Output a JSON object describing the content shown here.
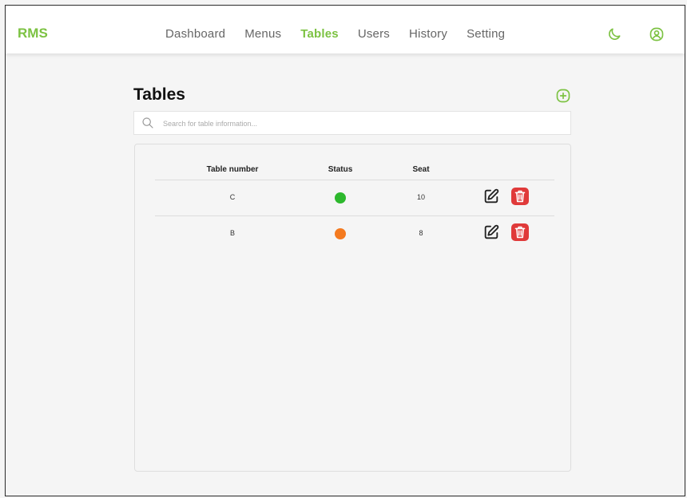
{
  "navbar": {
    "brand": "RMS",
    "links": [
      {
        "label": "Dashboard",
        "active": false
      },
      {
        "label": "Menus",
        "active": false
      },
      {
        "label": "Tables",
        "active": true
      },
      {
        "label": "Users",
        "active": false
      },
      {
        "label": "History",
        "active": false
      },
      {
        "label": "Setting",
        "active": false
      }
    ],
    "icons": [
      "moon-icon",
      "user-circle-icon"
    ]
  },
  "page": {
    "title": "Tables",
    "add_icon": "plus-circle-icon"
  },
  "search": {
    "placeholder": "Search for table information...",
    "value": "",
    "icon": "search-icon"
  },
  "table": {
    "headers": {
      "number": "Table number",
      "status": "Status",
      "seat": "Seat"
    },
    "rows": [
      {
        "number": "C",
        "status_color": "#2db82d",
        "seat": "10"
      },
      {
        "number": "B",
        "status_color": "#f47a1f",
        "seat": "8"
      }
    ],
    "action_icons": [
      "edit-icon",
      "trash-icon"
    ]
  },
  "colors": {
    "accent": "#7cc242",
    "danger": "#e03a3a",
    "status_available": "#2db82d",
    "status_occupied": "#f47a1f"
  }
}
